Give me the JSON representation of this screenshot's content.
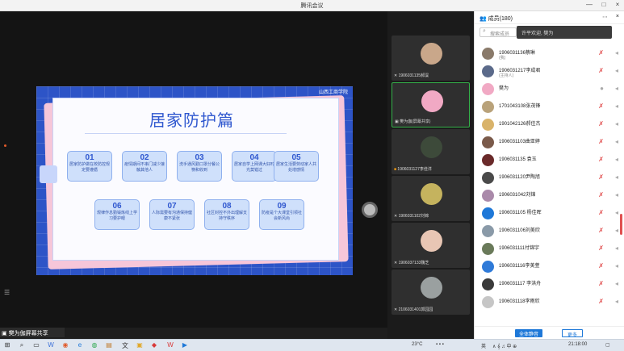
{
  "window": {
    "title": "腾讯会议",
    "controls": [
      "—",
      "□",
      "×"
    ]
  },
  "slide": {
    "brand": "山西工商学院",
    "heading": "居家防护篇",
    "items": [
      {
        "num": "01",
        "text": "居家防护做在校防控规定要遵循"
      },
      {
        "num": "02",
        "text": "疫情期间不串门减少接触其他人"
      },
      {
        "num": "03",
        "text": "洗手通风勤口罩分餐公筷和收到"
      },
      {
        "num": "04",
        "text": "居家自学上网课大好时光莫错过"
      },
      {
        "num": "05",
        "text": "居家生活要劳动家人共处增感情"
      },
      {
        "num": "06",
        "text": "规律作息勤锻炼线上学习要护眼"
      },
      {
        "num": "07",
        "text": "人际需要有沟通保持健康不紧张"
      },
      {
        "num": "08",
        "text": "社区封控不外出理解支持守秩序"
      },
      {
        "num": "09",
        "text": "防疫是个大课堂引领社会新风尚"
      }
    ]
  },
  "share_bar": {
    "label": "樊为伽屏幕共享"
  },
  "video_tiles": [
    {
      "name": "1906031135郝淏",
      "color": "#c9a78a",
      "active": false,
      "icon": "mic-muted-icon"
    },
    {
      "name": "樊为伽(屏幕共享)",
      "color": "#f1a9c4",
      "active": true,
      "icon": "screen-share-icon"
    },
    {
      "name": "1906031127李佳洋",
      "color": "#3d4a3a",
      "active": false,
      "icon": "camera-icon"
    },
    {
      "name": "1906031102刘锦",
      "color": "#c5b35e",
      "active": false,
      "icon": "mic-muted-icon"
    },
    {
      "name": "1906037133魏芝",
      "color": "#e8c6b4",
      "active": false,
      "icon": "mic-muted-icon"
    },
    {
      "name": "2106031401郭园园",
      "color": "#9aa0a0",
      "active": false,
      "icon": "mic-muted-icon"
    }
  ],
  "participants_panel": {
    "title": "成员(180)",
    "search_placeholder": "搜索成员",
    "toast": "许平欢迎, 樊为",
    "members": [
      {
        "name": "1906031136蔡琳",
        "sub": "(我)",
        "color": "#8a7a6a"
      },
      {
        "name": "1906031217李成君",
        "sub": "(主持人)",
        "color": "#5b6a8a"
      },
      {
        "name": "樊为",
        "sub": "",
        "color": "#f1a9c4"
      },
      {
        "name": "1701043108张茂锋",
        "sub": "",
        "color": "#b9a27a"
      },
      {
        "name": "1901042126郝佳杰",
        "sub": "",
        "color": "#d9b36a"
      },
      {
        "name": "1906031103曲亚婷",
        "sub": "",
        "color": "#7a5a4a"
      },
      {
        "name": "1906031135 袁玉",
        "sub": "",
        "color": "#6a2a2a"
      },
      {
        "name": "1906031120尹陶旭",
        "sub": "",
        "color": "#4a4a4a"
      },
      {
        "name": "1906031042刘锦",
        "sub": "",
        "color": "#aa8aaa"
      },
      {
        "name": "1906031105 杨佳晖",
        "sub": "",
        "color": "#1e78d8"
      },
      {
        "name": "1906031106刘美欣",
        "sub": "",
        "color": "#8a9aa8"
      },
      {
        "name": "1906031111付锦宇",
        "sub": "",
        "color": "#6a7a5a"
      },
      {
        "name": "1906031116李美萱",
        "sub": "",
        "color": "#2f7ad8"
      },
      {
        "name": "1906031117 李洪舟",
        "sub": "",
        "color": "#3a3a3a"
      },
      {
        "name": "1906031118李雨欣",
        "sub": "",
        "color": "#c6c6c6"
      }
    ],
    "buttons": {
      "mute_all": "全体静音",
      "more": "更多"
    }
  },
  "taskbar": {
    "weather": "23°C",
    "ime": "英",
    "time": "21:18:00",
    "tray_text": "∧ 𝄞 ♫ 中 ⊕"
  }
}
